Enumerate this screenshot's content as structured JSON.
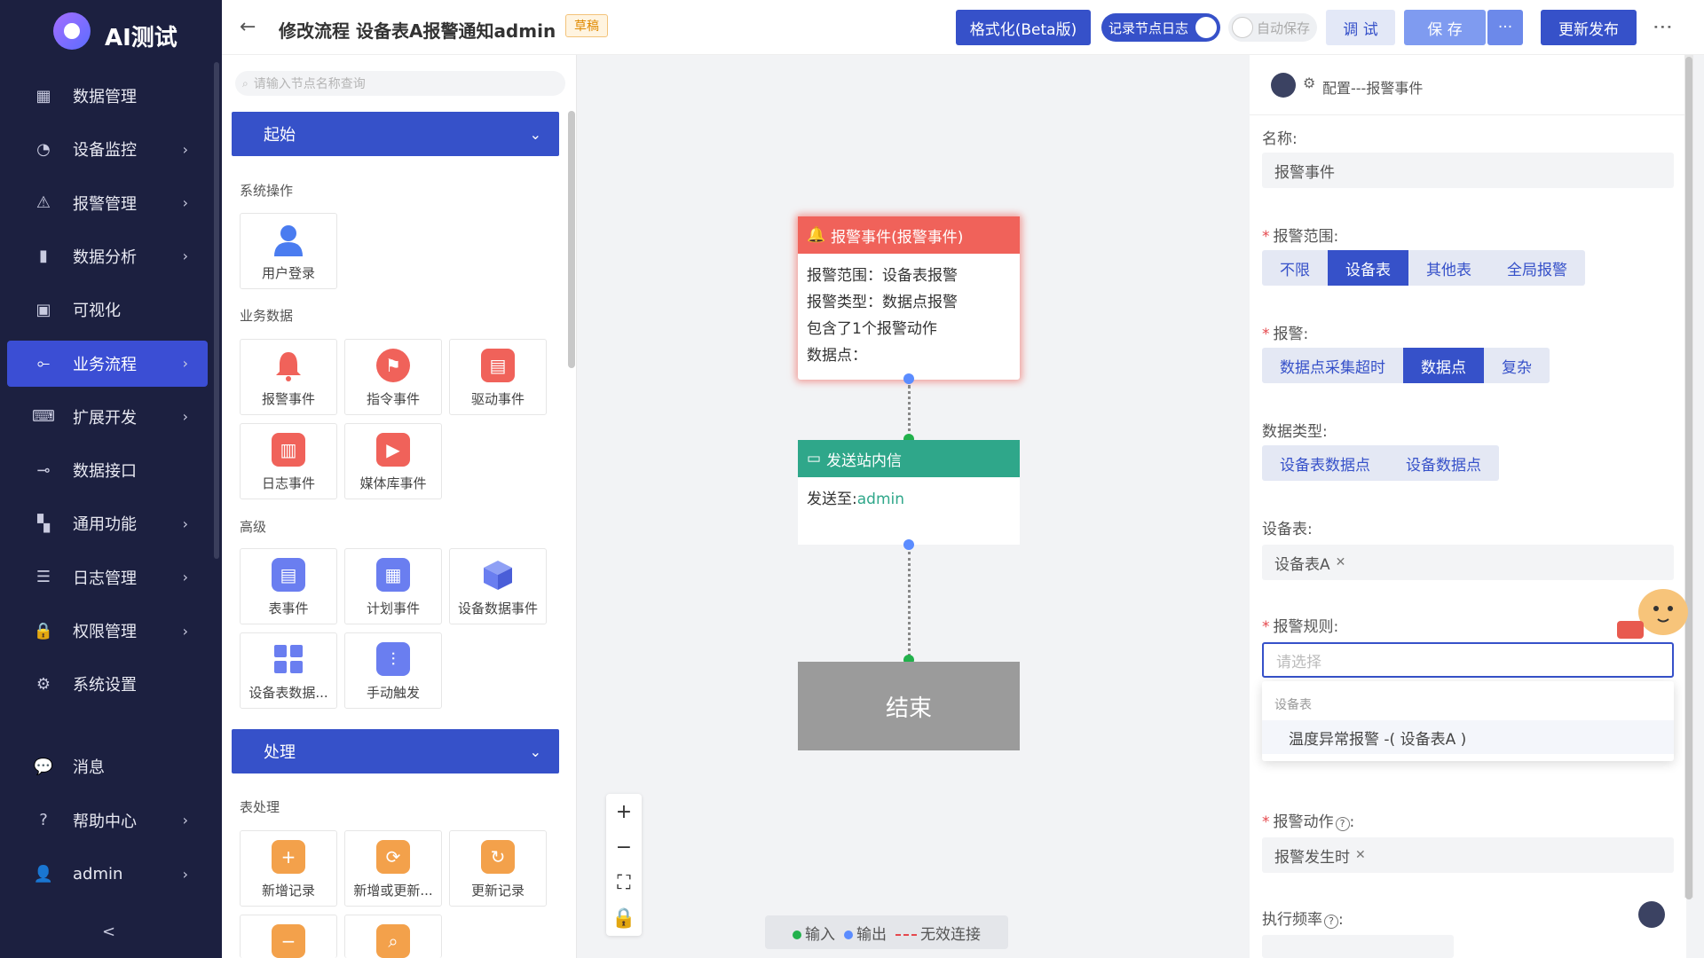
{
  "app": {
    "title": "AI测试"
  },
  "sidebar": {
    "items": [
      {
        "label": "数据管理",
        "icon": "dashboard-icon",
        "glyph": "▦",
        "chevron": false
      },
      {
        "label": "设备监控",
        "icon": "monitor-icon",
        "glyph": "◔",
        "chevron": true
      },
      {
        "label": "报警管理",
        "icon": "alarm-icon",
        "glyph": "⚠",
        "chevron": true
      },
      {
        "label": "数据分析",
        "icon": "bar-chart-icon",
        "glyph": "▮",
        "chevron": true
      },
      {
        "label": "可视化",
        "icon": "screen-icon",
        "glyph": "▣",
        "chevron": false
      },
      {
        "label": "业务流程",
        "icon": "flow-icon",
        "glyph": "⟜",
        "chevron": true,
        "active": true
      },
      {
        "label": "扩展开发",
        "icon": "code-icon",
        "glyph": "⌨",
        "chevron": true
      },
      {
        "label": "数据接口",
        "icon": "plug-icon",
        "glyph": "⊸",
        "chevron": false
      },
      {
        "label": "通用功能",
        "icon": "grid-icon",
        "glyph": "▚",
        "chevron": true
      },
      {
        "label": "日志管理",
        "icon": "log-icon",
        "glyph": "☰",
        "chevron": true
      },
      {
        "label": "权限管理",
        "icon": "lock-icon",
        "glyph": "🔒",
        "chevron": true
      },
      {
        "label": "系统设置",
        "icon": "gear-icon",
        "glyph": "⚙",
        "chevron": false
      }
    ],
    "bottom": [
      {
        "label": "消息",
        "icon": "message-icon",
        "glyph": "💬",
        "chevron": false
      },
      {
        "label": "帮助中心",
        "icon": "help-icon",
        "glyph": "?",
        "chevron": true
      },
      {
        "label": "admin",
        "icon": "user-icon",
        "glyph": "👤",
        "chevron": true
      }
    ],
    "collapse_glyph": "<"
  },
  "header": {
    "back_glyph": "←",
    "title": "修改流程 设备表A报警通知admin",
    "status": "草稿",
    "format_label": "格式化(Beta版)",
    "log_toggle_label": "记录节点日志",
    "autosave_label": "自动保存",
    "debug_label": "调 试",
    "save_label": "保 存",
    "save_more": "···",
    "publish_label": "更新发布",
    "more": "⋮"
  },
  "palette": {
    "search_placeholder": "请输入节点名称查询",
    "section_start": "起始",
    "section_process": "处理",
    "groups": {
      "system": "系统操作",
      "business": "业务数据",
      "advanced": "高级",
      "table": "表处理"
    },
    "tiles": {
      "user_login": "用户登录",
      "alarm_event": "报警事件",
      "command_event": "指令事件",
      "driver_event": "驱动事件",
      "log_event": "日志事件",
      "media_event": "媒体库事件",
      "table_event": "表事件",
      "plan_event": "计划事件",
      "device_data_event": "设备数据事件",
      "device_table_data": "设备表数据...",
      "manual_trigger": "手动触发",
      "add_record": "新增记录",
      "add_or_update": "新增或更新...",
      "update_record": "更新记录"
    }
  },
  "flow": {
    "alarm_node": {
      "title": "报警事件(报警事件)",
      "lines": [
        "报警范围：设备表报警",
        "报警类型：数据点报警",
        "包含了1个报警动作",
        "数据点："
      ]
    },
    "message_node": {
      "title": "发送站内信",
      "send_to_label": "发送至:",
      "send_to_value": "admin"
    },
    "end_node": {
      "label": "结束"
    },
    "legend": {
      "input": "输入",
      "output": "输出",
      "invalid": "无效连接"
    },
    "colors": {
      "alarm": "#f0625a",
      "message": "#2fa78a",
      "input": "#22b14c",
      "output": "#5b8cff",
      "invalid": "#e5484d"
    }
  },
  "config": {
    "header": "配置---报警事件",
    "name_label": "名称:",
    "name_value": "报警事件",
    "scope_label": "报警范围:",
    "scope_options": [
      "不限",
      "设备表",
      "其他表",
      "全局报警"
    ],
    "scope_selected": "设备表",
    "alarm_label": "报警:",
    "alarm_options": [
      "数据点采集超时",
      "数据点",
      "复杂"
    ],
    "alarm_selected": "数据点",
    "datatype_label": "数据类型:",
    "datatype_options": [
      "设备表数据点",
      "设备数据点"
    ],
    "table_label": "设备表:",
    "table_value": "设备表A",
    "rule_label": "报警规则:",
    "rule_placeholder": "请选择",
    "dropdown_group": "设备表",
    "dropdown_option": "温度异常报警 -( 设备表A )",
    "action_label": "报警动作",
    "action_value": "报警发生时",
    "frequency_label": "执行频率",
    "help_glyph": "?"
  }
}
